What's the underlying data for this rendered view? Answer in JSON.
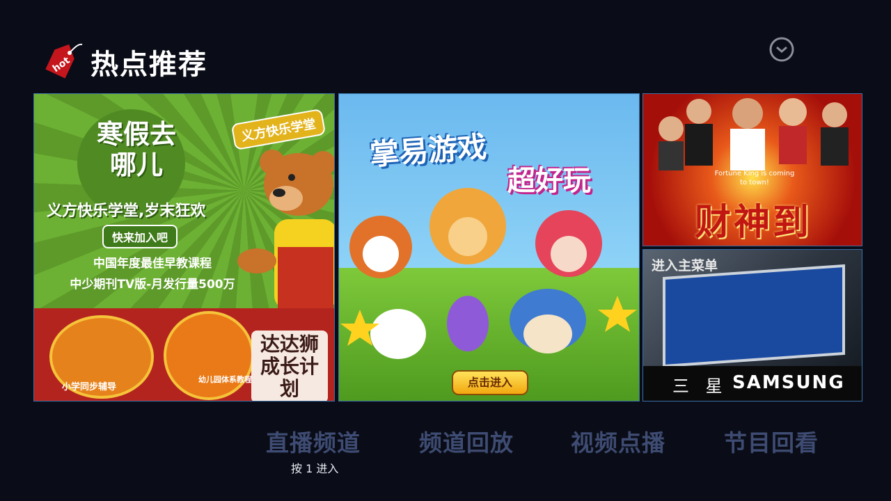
{
  "header": {
    "title": "热点推荐",
    "tag_text": "hot"
  },
  "tiles": [
    {
      "id": "tile-kids-education",
      "headline": "寒假去哪儿",
      "brand": "义方快乐学堂",
      "slogan": "义方快乐学堂,岁末狂欢",
      "join_button": "快来加入吧",
      "line1": "中国年度最佳早教课程",
      "line2": "中少期刊TV版-月发行量500万",
      "badge1": "小学同步辅导",
      "badge2": "幼儿园体系教程",
      "badge3": "达达狮成长计划"
    },
    {
      "id": "tile-games",
      "title": "掌易游戏",
      "subtitle": "超好玩",
      "button": "点击进入"
    },
    {
      "id": "tile-movie",
      "english": "Fortune King is coming to town!",
      "title": "财神到"
    },
    {
      "id": "tile-samsung",
      "label": "进入主菜单",
      "brand_cn": "三 星",
      "brand_en": "SAMSUNG"
    }
  ],
  "menu": {
    "items": [
      "直播频道",
      "频道回放",
      "视频点播",
      "节目回看"
    ],
    "hint": "按 1 进入"
  },
  "colors": {
    "background": "#0a0d17",
    "menu_text": "#3e4b72",
    "tile_border": "#3a6fa8"
  }
}
